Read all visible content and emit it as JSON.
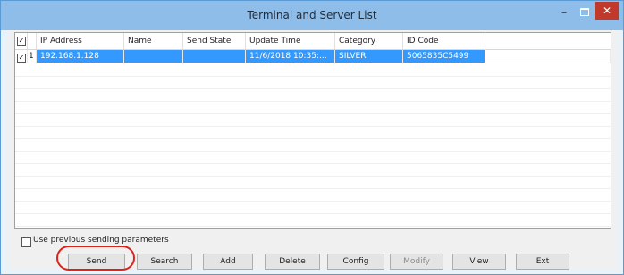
{
  "window": {
    "title": "Terminal and Server List",
    "minimize": "–",
    "close": "✕"
  },
  "table": {
    "headers": [
      "IP Address",
      "Name",
      "Send State",
      "Update Time",
      "Category",
      "ID Code"
    ],
    "rows": [
      {
        "checked": true,
        "index": "1",
        "ip": "192.168.1.128",
        "name": "",
        "state": "",
        "time": "11/6/2018 10:35:...",
        "category": "SILVER",
        "id": "5065835C5499"
      }
    ]
  },
  "options": {
    "use_previous_label": "Use previous sending parameters",
    "use_previous_checked": false
  },
  "buttons": {
    "send": "Send",
    "search": "Search",
    "add": "Add",
    "delete": "Delete",
    "config": "Config",
    "modify": "Modify",
    "view": "View",
    "exit": "Ext"
  },
  "colors": {
    "title_bar": "#8ebde9",
    "selection": "#3399ff",
    "close": "#c0392b",
    "highlight": "#d9231b"
  }
}
